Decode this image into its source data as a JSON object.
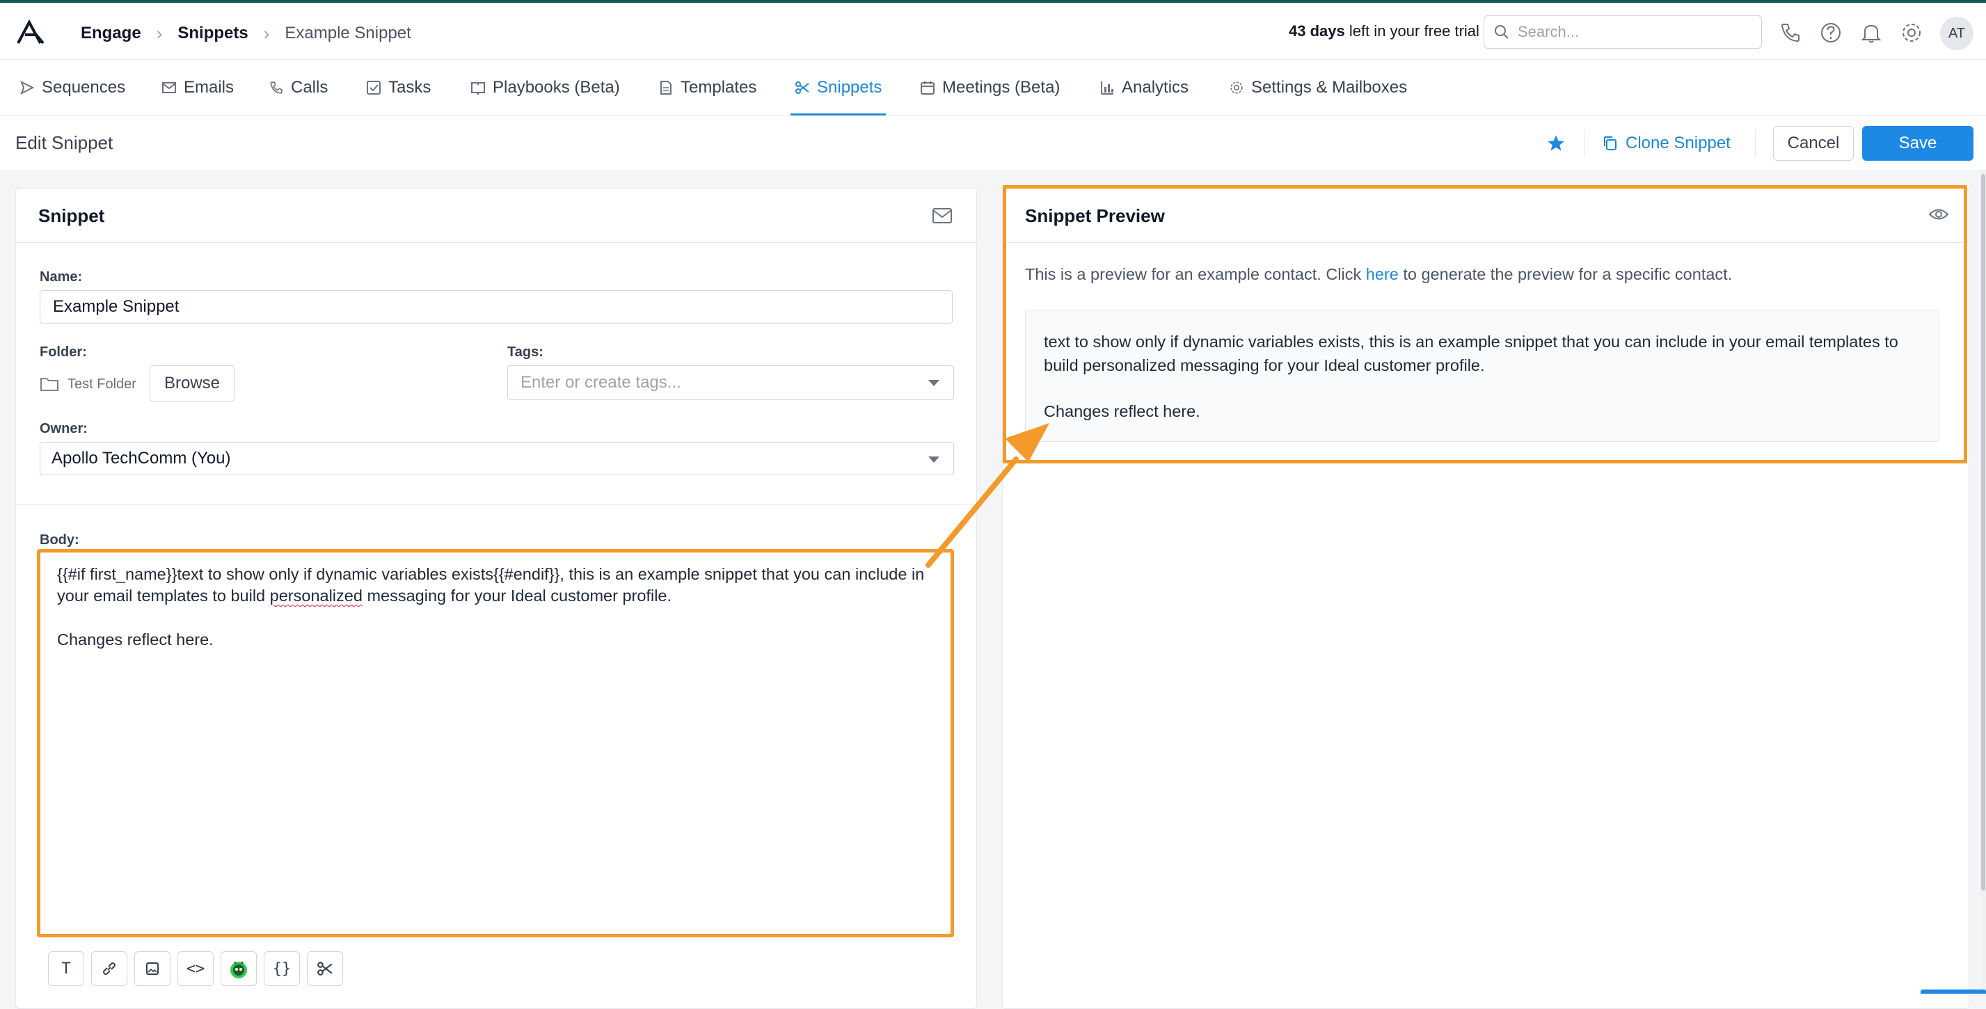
{
  "breadcrumb": {
    "items": [
      "Engage",
      "Snippets",
      "Example Snippet"
    ]
  },
  "trial": {
    "days": "43 days",
    "suffix": " left in your free trial"
  },
  "search": {
    "placeholder": "Search..."
  },
  "user": {
    "initials": "AT"
  },
  "nav": {
    "tabs": [
      {
        "label": "Sequences",
        "icon": "send-icon"
      },
      {
        "label": "Emails",
        "icon": "mail-icon"
      },
      {
        "label": "Calls",
        "icon": "phone-icon"
      },
      {
        "label": "Tasks",
        "icon": "checkbox-icon"
      },
      {
        "label": "Playbooks (Beta)",
        "icon": "book-icon"
      },
      {
        "label": "Templates",
        "icon": "document-icon"
      },
      {
        "label": "Snippets",
        "icon": "scissors-icon",
        "active": true
      },
      {
        "label": "Meetings (Beta)",
        "icon": "calendar-icon"
      },
      {
        "label": "Analytics",
        "icon": "bar-chart-icon"
      },
      {
        "label": "Settings & Mailboxes",
        "icon": "gear-icon"
      }
    ]
  },
  "page": {
    "title": "Edit Snippet",
    "clone_label": "Clone Snippet",
    "cancel_label": "Cancel",
    "save_label": "Save"
  },
  "snippet": {
    "title": "Snippet",
    "name_label": "Name:",
    "name_value": "Example Snippet",
    "folder_label": "Folder:",
    "folder_value": "Test Folder",
    "browse_label": "Browse",
    "tags_label": "Tags:",
    "tags_placeholder": "Enter or create tags...",
    "owner_label": "Owner:",
    "owner_value": "Apollo TechComm (You)",
    "body_label": "Body:",
    "body_line1": "{{#if first_name}}text to show only if dynamic variables exists{{#endif}}, this is an example snippet that you can include in your email templates to build ",
    "body_misspelled": "personalized",
    "body_line1_end": " messaging for your Ideal customer profile.",
    "body_line2": "Changes reflect here.",
    "toolbar": [
      "T",
      "link",
      "image",
      "<>",
      "bot",
      "{}",
      "scissors"
    ]
  },
  "preview": {
    "title": "Snippet Preview",
    "note_before": "This is a preview for an example contact. Click ",
    "note_link": "here",
    "note_after": " to generate the preview for a specific contact.",
    "line1": "text to show only if dynamic variables exists, this is an example snippet that you can include in your email templates to build personalized messaging for your Ideal customer profile.",
    "line2": "Changes reflect here."
  },
  "colors": {
    "accent": "#1e88e5",
    "annotation": "#f39a2b",
    "brand": "#0f5b53"
  }
}
